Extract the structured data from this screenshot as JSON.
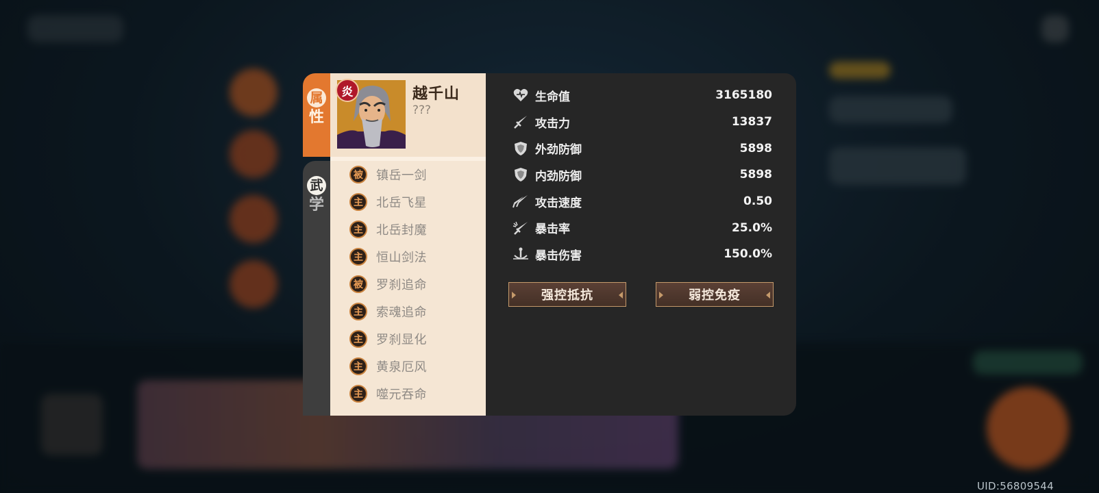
{
  "hero": {
    "element_badge": "炎",
    "name": "越千山",
    "subtitle": "???"
  },
  "tabs": {
    "attributes": [
      "属",
      "性"
    ],
    "martial": [
      "武",
      "学"
    ]
  },
  "skills": [
    {
      "type": "被",
      "name": "镇岳一剑"
    },
    {
      "type": "主",
      "name": "北岳飞星"
    },
    {
      "type": "主",
      "name": "北岳封魔"
    },
    {
      "type": "主",
      "name": "恒山剑法"
    },
    {
      "type": "被",
      "name": "罗刹追命"
    },
    {
      "type": "主",
      "name": "索魂追命"
    },
    {
      "type": "主",
      "name": "罗刹显化"
    },
    {
      "type": "主",
      "name": "黄泉厄风"
    },
    {
      "type": "主",
      "name": "噬元吞命"
    }
  ],
  "stats": [
    {
      "icon": "heart-icon",
      "label": "生命值",
      "value": "3165180"
    },
    {
      "icon": "sword-icon",
      "label": "攻击力",
      "value": "13837"
    },
    {
      "icon": "shield-icon",
      "label": "外劲防御",
      "value": "5898"
    },
    {
      "icon": "shield-icon",
      "label": "内劲防御",
      "value": "5898"
    },
    {
      "icon": "double-sword-icon",
      "label": "攻击速度",
      "value": "0.50"
    },
    {
      "icon": "crit-sword-icon",
      "label": "暴击率",
      "value": "25.0%"
    },
    {
      "icon": "anchor-icon",
      "label": "暴击伤害",
      "value": "150.0%"
    }
  ],
  "buttons": {
    "strong_control": "强控抵抗",
    "weak_control": "弱控免疫"
  },
  "uid": "UID:56809544",
  "colors": {
    "accent": "#e3782f",
    "panel_dark": "#262626",
    "panel_light": "#f5e6d4",
    "badge_red": "#b0182a"
  }
}
